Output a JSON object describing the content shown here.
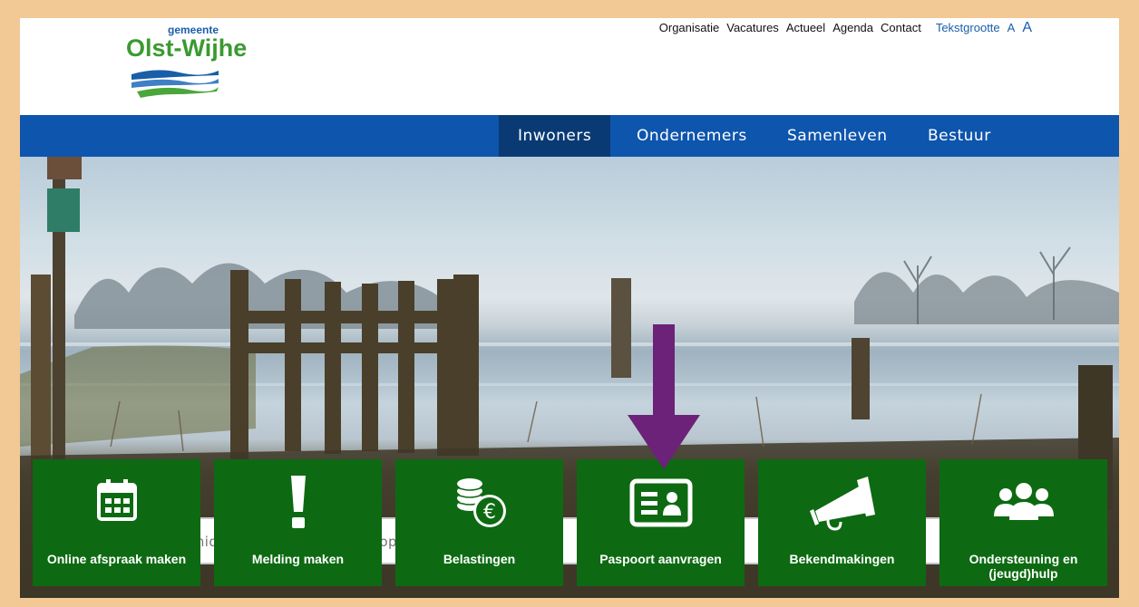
{
  "header": {
    "logo_small": "gemeente",
    "logo_main": "Olst-Wijhe"
  },
  "topnav": {
    "items": [
      "Organisatie",
      "Vacatures",
      "Actueel",
      "Agenda",
      "Contact"
    ],
    "textsize_label": "Tekstgrootte",
    "textsize_small": "A",
    "textsize_large": "A"
  },
  "mainnav": {
    "tabs": [
      "Inwoners",
      "Ondernemers",
      "Samenleven",
      "Bestuur"
    ],
    "active": "Inwoners"
  },
  "search": {
    "placeholder": "Goedemiddag, waar ben je naar op zoek?"
  },
  "tiles": [
    {
      "label": "Online afspraak maken",
      "icon": "calendar-icon"
    },
    {
      "label": "Melding maken",
      "icon": "exclamation-icon"
    },
    {
      "label": "Belastingen",
      "icon": "coins-euro-icon"
    },
    {
      "label": "Paspoort aanvragen",
      "icon": "id-card-icon"
    },
    {
      "label": "Bekendmakingen",
      "icon": "megaphone-icon"
    },
    {
      "label": "Ondersteuning en (jeugd)hulp",
      "icon": "people-group-icon"
    }
  ],
  "colors": {
    "nav_blue": "#0e55ad",
    "nav_active": "#0a3a73",
    "tile_green": "#0d6a12",
    "arrow_purple": "#6b2278",
    "frame": "#f2c994"
  }
}
